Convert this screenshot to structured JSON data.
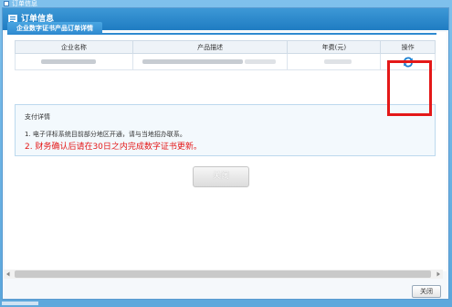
{
  "outer": {
    "title": "订单信息"
  },
  "dialog": {
    "title": "订单信息"
  },
  "tab": {
    "label": "企业数字证书产品订单详情"
  },
  "table": {
    "headers": [
      "企业名称",
      "产品描述",
      "年费(元)",
      "操作"
    ]
  },
  "payment": {
    "title": "支付详情",
    "line1": "1. 电子评标系统目前部分地区开通，请与当地招办联系。",
    "line2": "2. 财务确认后请在30日之内完成数字证书更新。"
  },
  "buttons": {
    "close_main": "关闭",
    "close_footer": "关闭"
  },
  "colors": {
    "accent": "#2f8ad0",
    "highlight": "#e41818"
  },
  "icons": {
    "action": "refresh-icon"
  }
}
